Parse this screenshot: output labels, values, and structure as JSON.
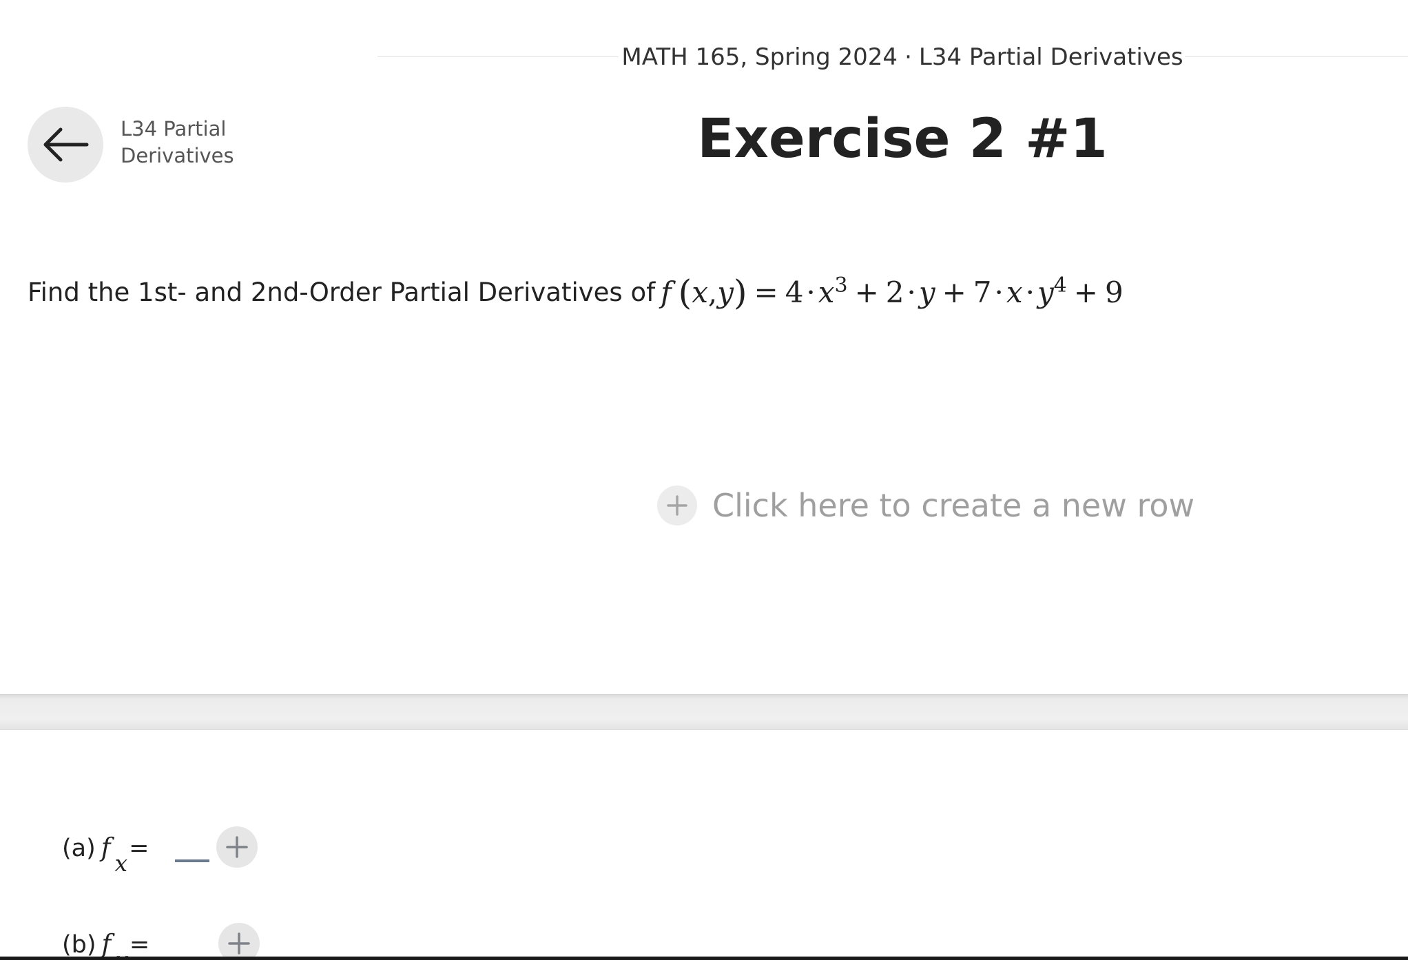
{
  "header": {
    "course": "MATH 165, Spring 2024",
    "separator": "·",
    "lesson": "L34 Partial Derivatives"
  },
  "back": {
    "icon": "arrow-left-icon",
    "label_line1": "L34 Partial",
    "label_line2": "Derivatives"
  },
  "title": "Exercise 2 #1",
  "problem": {
    "text": "Find the 1st- and 2nd-Order Partial Derivatives of",
    "math": {
      "f": "f",
      "x": "x",
      "comma": ",",
      "y": "y",
      "eq": "=",
      "c1": "4",
      "x1": "x",
      "e1": "3",
      "plus1": "+",
      "c2": "2",
      "y1": "y",
      "plus2": "+",
      "c3": "7",
      "x2": "x",
      "y2": "y",
      "e2": "4",
      "plus3": "+",
      "c4": "9"
    }
  },
  "new_row": {
    "icon": "plus-icon",
    "text": "Click here to create a new row"
  },
  "answers": [
    {
      "label": "(a)",
      "f": "f",
      "sub": "x",
      "eq": "="
    },
    {
      "label": "(b)",
      "f": "f",
      "sub": "y",
      "eq": "="
    }
  ],
  "colors": {
    "title": "#222222",
    "muted_text": "#9f9f9f",
    "button_bg": "#e9e9e9",
    "blank_line": "#6a7a8c"
  }
}
